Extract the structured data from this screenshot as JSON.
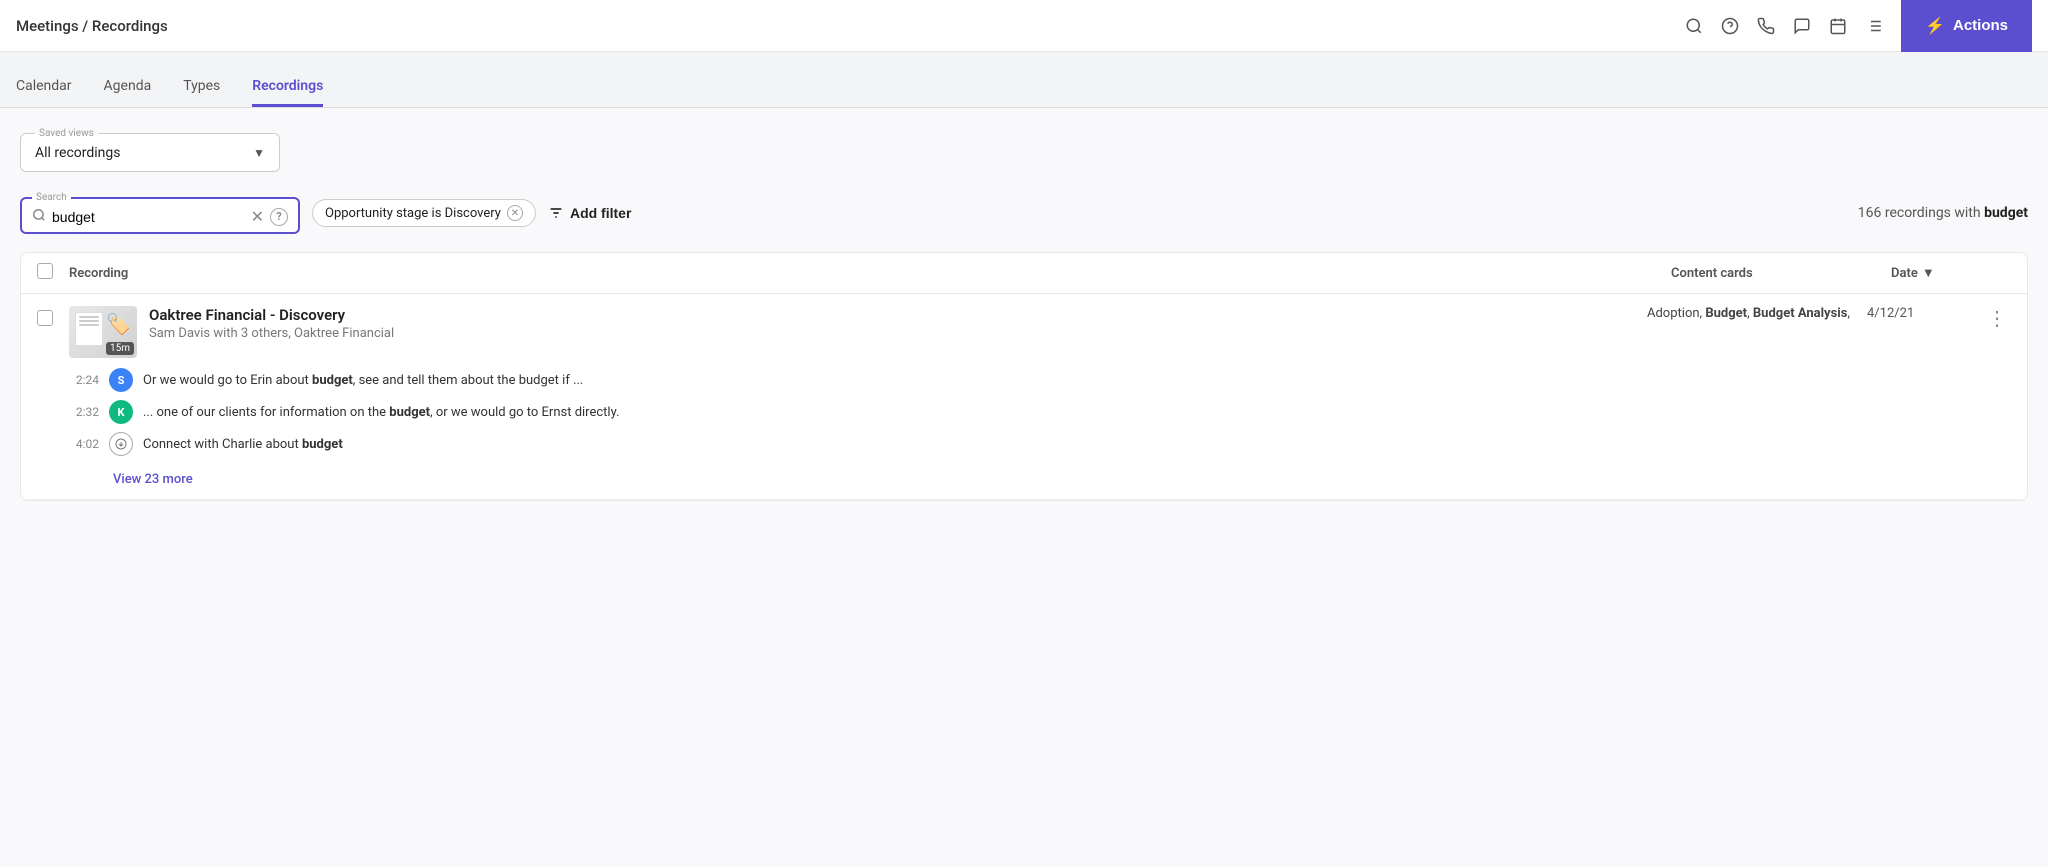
{
  "topNav": {
    "title": "Meetings / Recordings",
    "actionsLabel": "Actions",
    "boltSymbol": "⚡"
  },
  "tabs": [
    {
      "id": "calendar",
      "label": "Calendar",
      "active": false
    },
    {
      "id": "agenda",
      "label": "Agenda",
      "active": false
    },
    {
      "id": "types",
      "label": "Types",
      "active": false
    },
    {
      "id": "recordings",
      "label": "Recordings",
      "active": true
    }
  ],
  "savedViews": {
    "legend": "Saved views",
    "selected": "All recordings"
  },
  "search": {
    "legend": "Search",
    "value": "budget",
    "placeholder": "Search..."
  },
  "filter": {
    "label": "Opportunity stage",
    "operator": "is",
    "value": "Discovery"
  },
  "addFilterLabel": "Add filter",
  "resultsText": "166 recordings with",
  "resultsQuery": "budget",
  "tableHeaders": {
    "recording": "Recording",
    "contentCards": "Content cards",
    "date": "Date"
  },
  "recordings": [
    {
      "id": "r1",
      "title": "Oaktree Financial - Discovery",
      "subtitle": "Sam Davis with 3 others, Oaktree Financial",
      "duration": "15m",
      "contentCards": "Adoption, Budget, Budget Analysis,",
      "date": "4/12/21",
      "transcriptLines": [
        {
          "time": "2:24",
          "speaker": "S",
          "avatarColor": "blue",
          "text": "Or we would go to Erin about ",
          "boldWord": "budget",
          "textAfter": ", see and tell them about the budget if ..."
        },
        {
          "time": "2:32",
          "speaker": "K",
          "avatarColor": "green",
          "text": "... one of our clients for information on the ",
          "boldWord": "budget",
          "textAfter": ", or we would go to Ernst directly."
        },
        {
          "time": "4:02",
          "speaker": null,
          "avatarColor": "icon",
          "text": "Connect with Charlie about ",
          "boldWord": "budget",
          "textAfter": ""
        }
      ],
      "viewMoreLabel": "View 23 more",
      "viewMoreCount": 23
    }
  ]
}
